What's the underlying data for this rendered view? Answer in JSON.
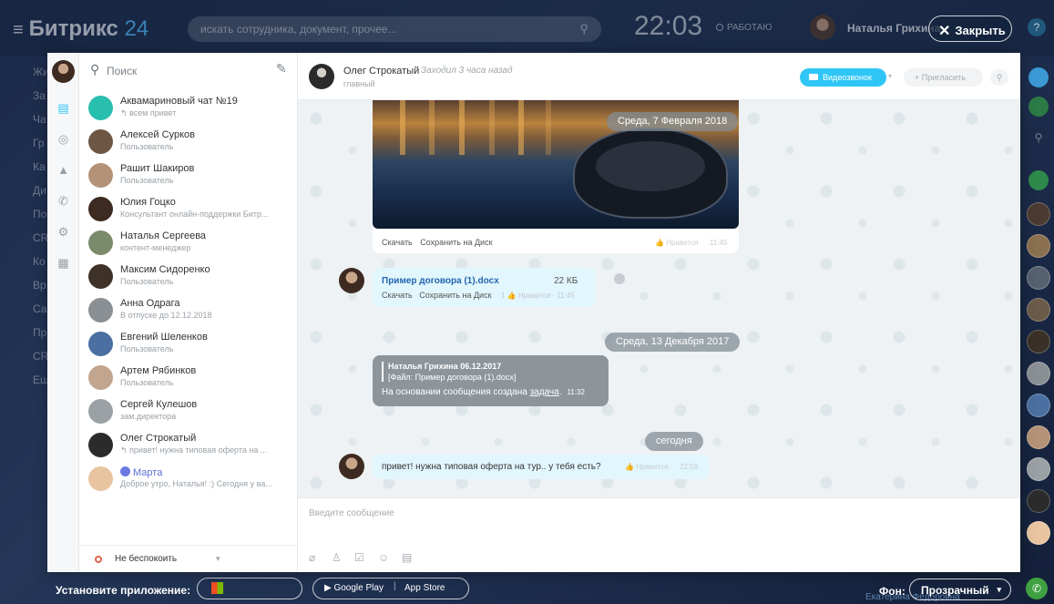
{
  "portal": {
    "logo_name": "Битрикс",
    "logo_num": "24",
    "search_placeholder": "искать сотрудника, документ, прочее...",
    "clock": "22:03",
    "status": "РАБОТАЮ",
    "user_name": "Наталья Грихина",
    "close_label": "Закрыть",
    "help": "?",
    "left_menu_ghosts": [
      "Жи",
      "За",
      "Ча",
      "Гр",
      "Ка",
      "Ди",
      "По",
      "CR",
      "Ко",
      "Вр",
      "Са",
      "Пр",
      "CR",
      "Ещ"
    ],
    "bottom_ghost": "Екатерина Фёдоровна"
  },
  "bottom": {
    "install_label": "Установите приложение:",
    "google_play": "Google Play",
    "app_store": "App Store",
    "background_label": "Фон:",
    "background_value": "Прозрачный"
  },
  "sidebar": {
    "search_placeholder": "Поиск",
    "contacts": [
      {
        "name": "Аквамариновый чат №19",
        "sub": "↰ всем привет",
        "color": "#29bfae"
      },
      {
        "name": "Алексей Сурков",
        "sub": "Пользователь",
        "color": "#6d5644"
      },
      {
        "name": "Рашит Шакиров",
        "sub": "Пользователь",
        "color": "#b49277"
      },
      {
        "name": "Юлия Гоцко",
        "sub": "Консультант онлайн-поддержки Битр...",
        "color": "#3d2a20"
      },
      {
        "name": "Наталья Сергеева",
        "sub": "контент-менеджер",
        "color": "#7a8a6a"
      },
      {
        "name": "Максим Сидоренко",
        "sub": "Пользователь",
        "color": "#3e3228"
      },
      {
        "name": "Анна Одрага",
        "sub": "В отпуске до 12.12.2018",
        "color": "#8a8f94"
      },
      {
        "name": "Евгений Шеленков",
        "sub": "Пользователь",
        "color": "#4a6fa0"
      },
      {
        "name": "Артем Рябинков",
        "sub": "Пользователь",
        "color": "#c2a58e"
      },
      {
        "name": "Сергей Кулешов",
        "sub": "зам.директора",
        "color": "#9aa0a4"
      },
      {
        "name": "Олег Строкатый",
        "sub": "↰ привет! нужна типовая оферта на ...",
        "color": "#2b2b2b"
      },
      {
        "name": "Марта",
        "sub": "Доброе утро, Наталья! :) Сегодня у ва...",
        "color": "#e8c5a0",
        "bot": true
      }
    ],
    "dnd_label": "Не беспокоить"
  },
  "chat": {
    "header_name": "Олег Строкатый",
    "header_status": "Заходил 3 часа назад",
    "header_sub": "главный",
    "video_label": "Видеозвонок",
    "invite_label": "+ Пригласить",
    "date1": "Среда, 7 Февраля 2018",
    "img_actions": [
      "Скачать",
      "Сохранить на Диск"
    ],
    "img_like": "Нравится",
    "img_time": "11:45",
    "file_name": "Пример договора (1).docx",
    "file_size": "22 КБ",
    "file_actions": [
      "Скачать",
      "Сохранить на Диск"
    ],
    "file_meta": "1 👍 Нравится · 11:45",
    "date2": "Среда, 13 Декабря 2017",
    "quote_author": "Наталья Грихина  06.12.2017",
    "quote_file": "[Файл: Пример договора (1).docx]",
    "quote_text_before": "На основании сообщения создана ",
    "quote_link": "задача",
    "quote_text_after": ".",
    "quote_time": "11:32",
    "date3": "сегодня",
    "last_text": "привет! нужна типовая оферта на тур.. у тебя есть?",
    "last_like": "Нравится",
    "last_time": "22:59",
    "input_placeholder": "Введите сообщение"
  }
}
